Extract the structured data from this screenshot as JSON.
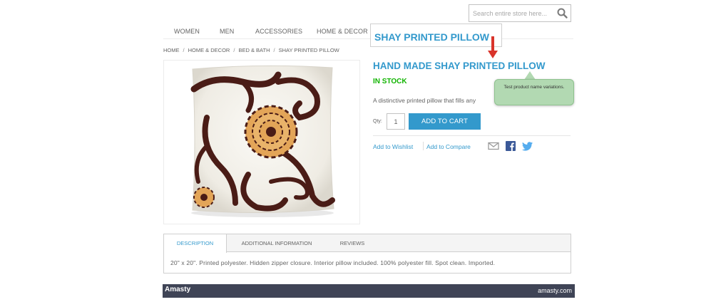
{
  "search": {
    "placeholder": "Search entire store here..."
  },
  "nav": {
    "items": [
      "WOMEN",
      "MEN",
      "ACCESSORIES",
      "HOME & DECOR"
    ]
  },
  "breadcrumb": {
    "items": [
      "HOME",
      "HOME & DECOR",
      "BED & BATH",
      "SHAY PRINTED PILLOW"
    ],
    "separator": "/"
  },
  "overlay": {
    "title": "SHAY PRINTED PILLOW"
  },
  "product": {
    "name": "HAND MADE SHAY PRINTED PILLOW",
    "stock": "IN STOCK",
    "short_description": "A distinctive printed pillow that fills any",
    "qty_label": "Qty:",
    "qty_value": "1",
    "add_to_cart_label": "ADD TO CART",
    "wishlist_label": "Add to Wishlist",
    "compare_label": "Add to Compare"
  },
  "tooltip": {
    "text": "Test product name variations."
  },
  "social": {
    "icons": [
      "email-icon",
      "facebook-icon",
      "twitter-icon"
    ]
  },
  "tabs": {
    "items": [
      "DESCRIPTION",
      "ADDITIONAL INFORMATION",
      "REVIEWS"
    ],
    "active": "DESCRIPTION",
    "content": "20\" x 20\". Printed polyester. Hidden zipper closure. Interior pillow included. 100% polyester fill. Spot clean. Imported."
  },
  "footer": {
    "logo": "Amasty",
    "url": "amasty.com"
  },
  "colors": {
    "accent": "#3399cc",
    "stock": "#11b400",
    "footer_bg": "#3f4456",
    "tooltip_bg": "#b2d9b2",
    "arrow": "#d9342b"
  }
}
